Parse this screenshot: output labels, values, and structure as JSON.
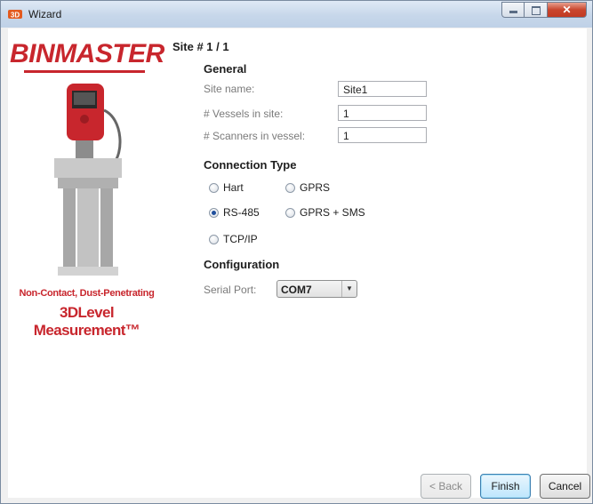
{
  "window": {
    "title": "Wizard",
    "controls": {
      "close_glyph": "✕"
    }
  },
  "logo": {
    "brand": "BINMASTER",
    "tagline_1": "Non-Contact, Dust-Penetrating",
    "tagline_2": "3DLevel Measurement™"
  },
  "page": {
    "title": "Site # 1 / 1"
  },
  "general": {
    "heading": "General",
    "site_name": {
      "label": "Site name:",
      "value": "Site1"
    },
    "vessels": {
      "label": "# Vessels in site:",
      "value": "1"
    },
    "scanners": {
      "label": "# Scanners in vessel:",
      "value": "1"
    }
  },
  "connection": {
    "heading": "Connection Type",
    "options": [
      {
        "label": "Hart",
        "selected": false
      },
      {
        "label": "GPRS",
        "selected": false
      },
      {
        "label": "RS-485",
        "selected": true
      },
      {
        "label": "GPRS + SMS",
        "selected": false
      },
      {
        "label": "TCP/IP",
        "selected": false
      }
    ]
  },
  "configuration": {
    "heading": "Configuration",
    "serial_port": {
      "label": "Serial Port:",
      "value": "COM7"
    }
  },
  "buttons": {
    "back": "< Back",
    "finish": "Finish",
    "cancel": "Cancel"
  },
  "colors": {
    "brand_red": "#c8262d",
    "selected_radio": "#1f4f9c"
  }
}
